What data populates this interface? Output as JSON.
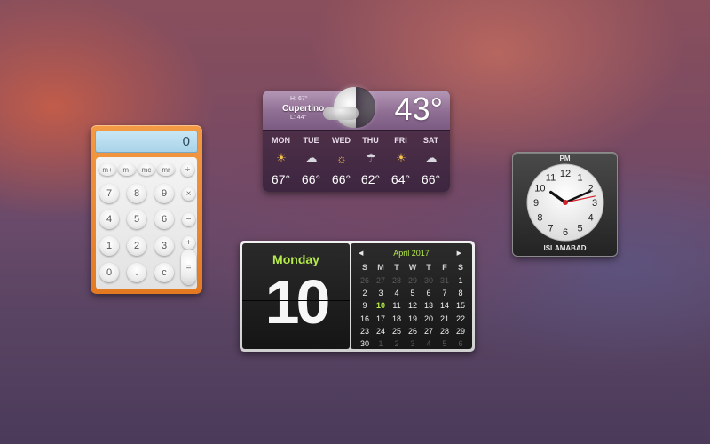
{
  "calculator": {
    "display": "0",
    "memory_keys": [
      "m+",
      "m-",
      "mc",
      "mr",
      "÷"
    ],
    "rows": [
      [
        "7",
        "8",
        "9",
        "×"
      ],
      [
        "4",
        "5",
        "6",
        "−"
      ],
      [
        "1",
        "2",
        "3",
        "+"
      ],
      [
        "0",
        ".",
        "c",
        "="
      ]
    ]
  },
  "weather": {
    "high": "H: 67°",
    "low": "L: 44°",
    "city": "Cupertino",
    "current_temp": "43°",
    "forecast": [
      {
        "day": "MON",
        "temp": "67°",
        "icon": "sun-cloud-icon"
      },
      {
        "day": "TUE",
        "temp": "66°",
        "icon": "cloud-icon"
      },
      {
        "day": "WED",
        "temp": "66°",
        "icon": "sun-icon"
      },
      {
        "day": "THU",
        "temp": "62°",
        "icon": "rain-icon"
      },
      {
        "day": "FRI",
        "temp": "64°",
        "icon": "sun-cloud-icon"
      },
      {
        "day": "SAT",
        "temp": "66°",
        "icon": "cloud-icon"
      }
    ]
  },
  "clock": {
    "ampm": "PM",
    "city": "ISLAMABAD",
    "numerals": [
      "12",
      "1",
      "2",
      "3",
      "4",
      "5",
      "6",
      "7",
      "8",
      "9",
      "10",
      "11"
    ],
    "hour": 10,
    "minute": 11,
    "second": 13
  },
  "calendar": {
    "weekday": "Monday",
    "day": "10",
    "month_label": "April 2017",
    "headers": [
      "S",
      "M",
      "T",
      "W",
      "T",
      "F",
      "S"
    ],
    "weeks": [
      [
        "26",
        "27",
        "28",
        "29",
        "30",
        "31",
        "1"
      ],
      [
        "2",
        "3",
        "4",
        "5",
        "6",
        "7",
        "8"
      ],
      [
        "9",
        "10",
        "11",
        "12",
        "13",
        "14",
        "15"
      ],
      [
        "16",
        "17",
        "18",
        "19",
        "20",
        "21",
        "22"
      ],
      [
        "23",
        "24",
        "25",
        "26",
        "27",
        "28",
        "29"
      ],
      [
        "30",
        "1",
        "2",
        "3",
        "4",
        "5",
        "6"
      ]
    ],
    "dim_cells": [
      [
        0,
        0
      ],
      [
        0,
        1
      ],
      [
        0,
        2
      ],
      [
        0,
        3
      ],
      [
        0,
        4
      ],
      [
        0,
        5
      ],
      [
        5,
        1
      ],
      [
        5,
        2
      ],
      [
        5,
        3
      ],
      [
        5,
        4
      ],
      [
        5,
        5
      ],
      [
        5,
        6
      ]
    ],
    "today_cell": [
      2,
      1
    ],
    "accent_color": "#b4ea4a"
  }
}
